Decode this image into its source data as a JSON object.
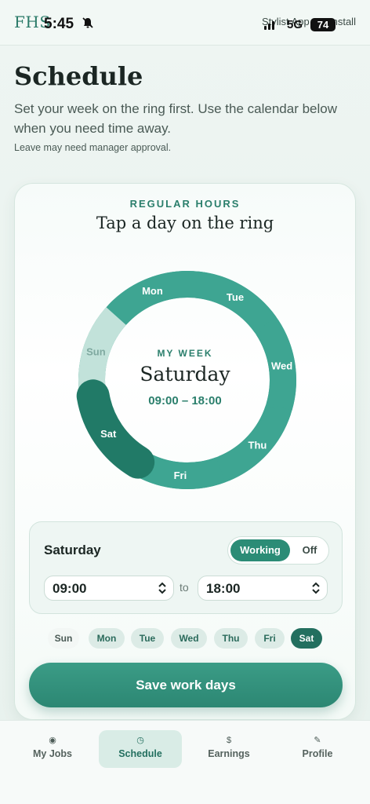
{
  "status": {
    "brand": "FHS",
    "time": "5:45",
    "app_label": "Stylist App",
    "install_label": "Install",
    "network": "5G",
    "battery": "74"
  },
  "header": {
    "title": "Schedule",
    "subtitle": "Set your week on the ring first. Use the calendar below when you need time away.",
    "note": "Leave may need manager approval."
  },
  "card": {
    "eyebrow": "REGULAR HOURS",
    "title": "Tap a day on the ring",
    "center_eyebrow": "MY WEEK",
    "center_day": "Saturday",
    "center_hours": "09:00 – 18:00",
    "ring_days": [
      "Sat",
      "Sun",
      "Mon",
      "Tue",
      "Wed",
      "Thu",
      "Fri"
    ],
    "ring_state": {
      "Sat": "selected",
      "Sun": "off",
      "Mon": "working",
      "Tue": "working",
      "Wed": "working",
      "Thu": "working",
      "Fri": "working"
    }
  },
  "editor": {
    "day": "Saturday",
    "working_label": "Working",
    "off_label": "Off",
    "start_time": "09:00",
    "to_label": "to",
    "end_time": "18:00"
  },
  "chips": [
    "Sun",
    "Mon",
    "Tue",
    "Wed",
    "Thu",
    "Fri",
    "Sat"
  ],
  "chip_active": "Sat",
  "save_label": "Save work days",
  "nav": [
    {
      "label": "My Jobs",
      "icon": "◉"
    },
    {
      "label": "Schedule",
      "icon": "◷"
    },
    {
      "label": "Earnings",
      "icon": "$"
    },
    {
      "label": "Profile",
      "icon": "✎"
    }
  ],
  "nav_active": "Schedule",
  "colors": {
    "accent": "#2b8c76",
    "accent_dark": "#236f5f",
    "ring_working": "#3ea592",
    "ring_off": "#c2e2da",
    "ring_selected": "#217a67"
  }
}
